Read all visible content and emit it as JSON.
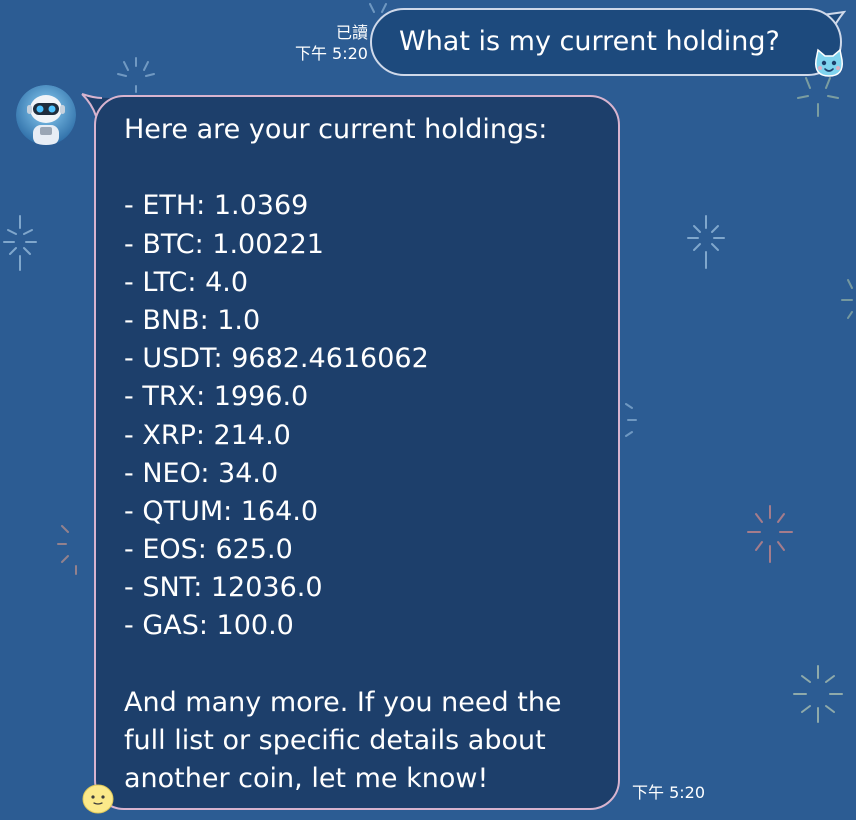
{
  "outgoing": {
    "read_status": "已讀",
    "time": "下午 5:20",
    "text": "What is my current holding?"
  },
  "incoming": {
    "intro": "Here are your current holdings:",
    "holdings": [
      "- ETH: 1.0369",
      "- BTC: 1.00221",
      "- LTC: 4.0",
      "- BNB: 1.0",
      "- USDT: 9682.4616062",
      "- TRX: 1996.0",
      "- XRP: 214.0",
      "- NEO: 34.0",
      "- QTUM: 164.0",
      "- EOS: 625.0",
      "- SNT: 12036.0",
      "- GAS: 100.0"
    ],
    "outro": "And many more. If you need the full list or specific details about another coin, let me know!",
    "time": "下午 5:20"
  },
  "colors": {
    "background": "#2c5c93",
    "outgoing_bubble": "#1d4a7d",
    "outgoing_border": "#cfd9ea",
    "incoming_bubble": "#1d3f6b",
    "incoming_border": "#d8b4cf"
  },
  "icons": {
    "avatar": "robot-avatar-icon",
    "outgoing_sticker": "cat-face-icon",
    "incoming_sticker": "smiley-face-icon",
    "background": "firework-icon"
  }
}
